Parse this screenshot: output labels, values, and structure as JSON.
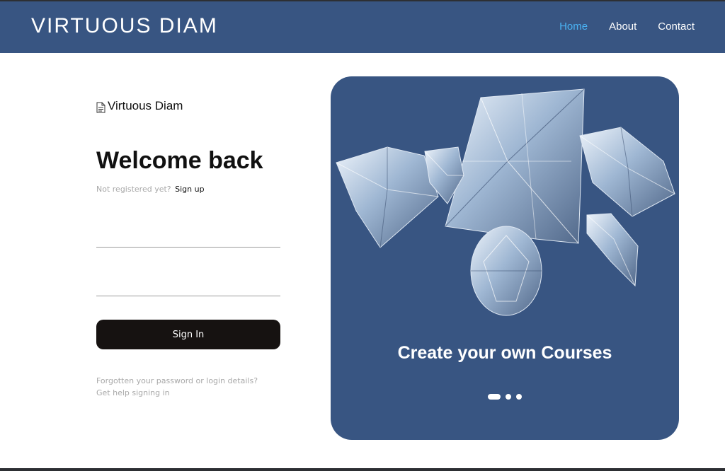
{
  "header": {
    "brand": "VIRTUOUS DIAM",
    "nav": [
      {
        "label": "Home",
        "active": true
      },
      {
        "label": "About",
        "active": false
      },
      {
        "label": "Contact",
        "active": false
      }
    ]
  },
  "login": {
    "logo_icon": "document-icon",
    "logo_text": "Virtuous Diam",
    "title": "Welcome back",
    "not_registered": "Not registered yet?",
    "signup_link": "Sign up",
    "username_value": "",
    "password_value": "",
    "submit_label": "Sign In",
    "help_line1": "Forgotten your password or login details?",
    "help_line2": "Get help signing in"
  },
  "promo": {
    "image": "diamonds-illustration",
    "caption": "Create your own Courses",
    "slides_total": 3,
    "active_slide": 1
  },
  "colors": {
    "primary": "#385582",
    "nav_active": "#4ab3f4",
    "button_bg": "#161211",
    "muted_text": "#a8a8a8"
  }
}
